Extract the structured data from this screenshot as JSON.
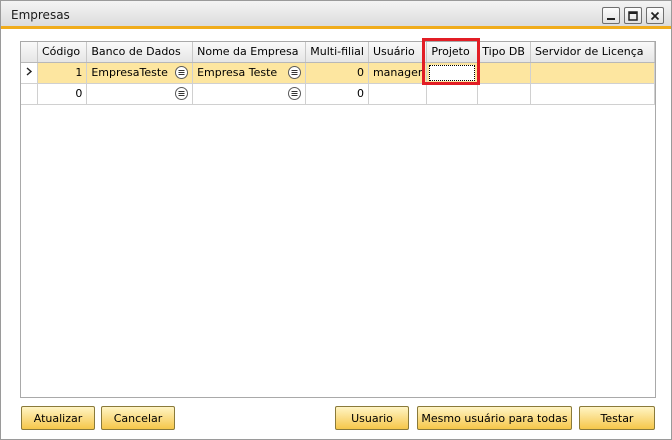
{
  "window": {
    "title": "Empresas"
  },
  "grid": {
    "columns": [
      "Código",
      "Banco de Dados",
      "Nome da Empresa",
      "Multi-filial",
      "Usuário",
      "Projeto",
      "Tipo DB",
      "Servidor de Licença"
    ],
    "rows": [
      {
        "codigo": "1",
        "banco": "EmpresaTeste",
        "nome": "Empresa Teste",
        "multifilial": "0",
        "usuario": "manager",
        "projeto": "",
        "tipo_db": "",
        "servidor": ""
      },
      {
        "codigo": "0",
        "banco": "",
        "nome": "",
        "multifilial": "0",
        "usuario": "",
        "projeto": "",
        "tipo_db": "",
        "servidor": ""
      }
    ],
    "row_indicator_icon": "chevron-right-icon",
    "link_icon": "link-arrow-icon"
  },
  "buttons": {
    "atualizar": "Atualizar",
    "cancelar": "Cancelar",
    "usuario": "Usuario",
    "mesmo_usuario": "Mesmo usuário para todas",
    "testar": "Testar"
  },
  "colors": {
    "accent": "#f0ac1c",
    "selected_row": "#fde6a0",
    "highlight": "#e21d25",
    "button": "#f6c74a"
  }
}
